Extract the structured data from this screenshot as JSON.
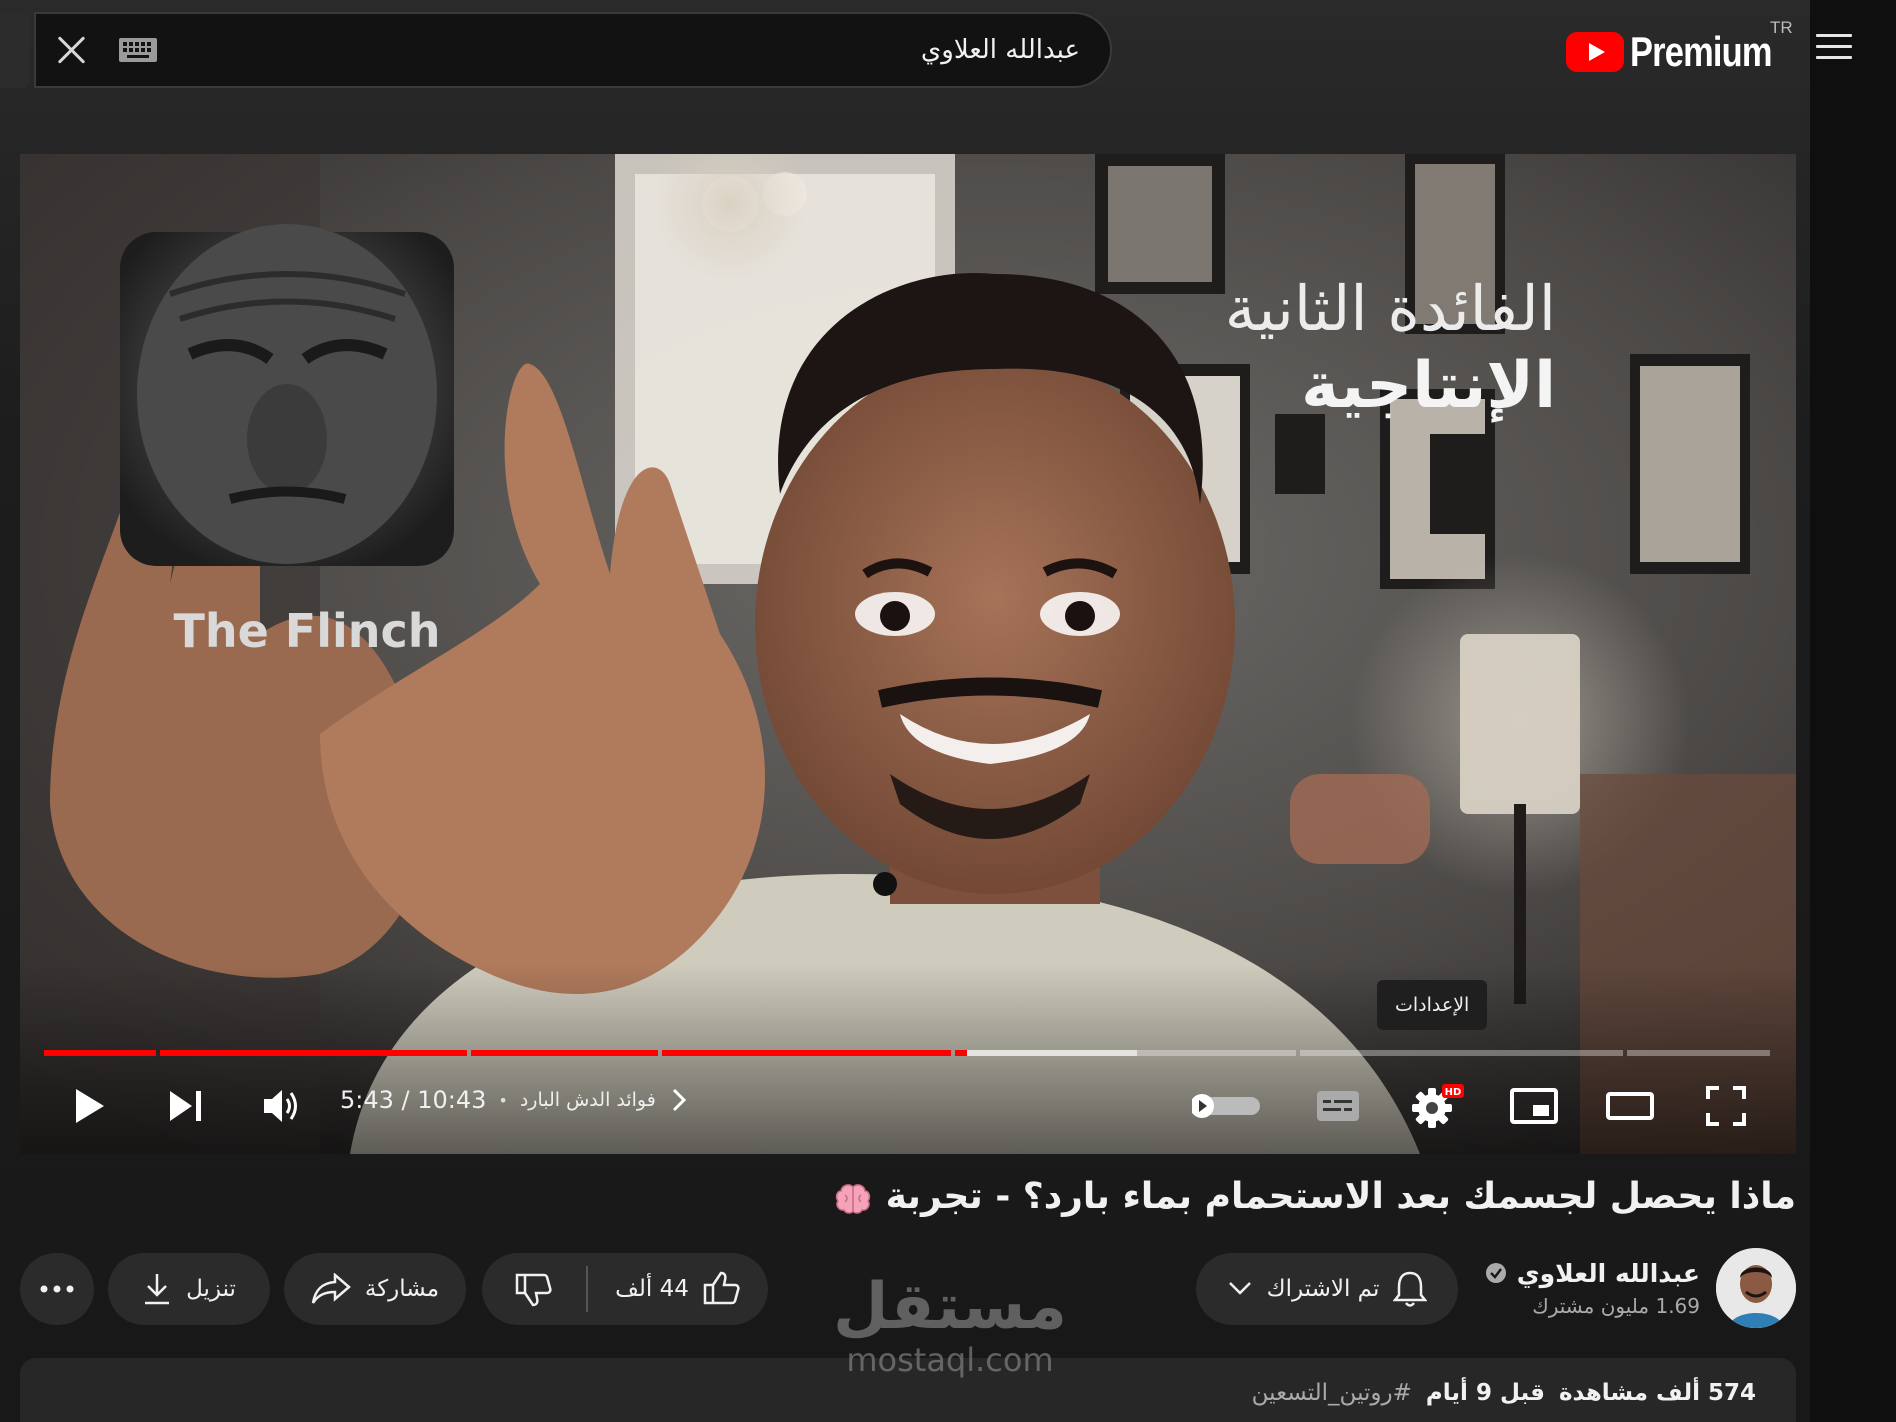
{
  "search": {
    "query": "عبدالله العلاوي"
  },
  "header": {
    "logo_text": "Premium",
    "region": "TR"
  },
  "player": {
    "overlay_line1": "الفائدة الثانية",
    "overlay_line2": "الإنتاجية",
    "card_caption": "The Flinch",
    "tooltip": "الإعدادات",
    "time_display": "5:43 / 10:43",
    "chapter": "فوائد الدش البارد",
    "progress_played_fraction": 0.533,
    "quality_badge": "HD",
    "accent_color": "#ff0000",
    "controls": [
      "play",
      "next",
      "volume",
      "autoplay-toggle",
      "subtitles",
      "settings",
      "miniplayer",
      "theater-mode",
      "fullscreen"
    ]
  },
  "video": {
    "title": "ماذا يحصل لجسمك بعد الاستحمام بماء بارد؟ - تجربة",
    "title_emoji": "brain-icon"
  },
  "channel": {
    "name": "عبدالله العلاوي",
    "subscribers": "1.69 مليون مشترك",
    "verified": true
  },
  "actions": {
    "subscribed_label": "تم الاشتراك",
    "like_count": "44 ألف",
    "share_label": "مشاركة",
    "download_label": "تنزيل"
  },
  "description": {
    "views": "574 ألف مشاهدة",
    "date": "قبل 9 أيام",
    "hashtag": "#روتين_التسعين"
  },
  "watermark": {
    "arabic": "مستقل",
    "latin": "mostaql.com"
  }
}
